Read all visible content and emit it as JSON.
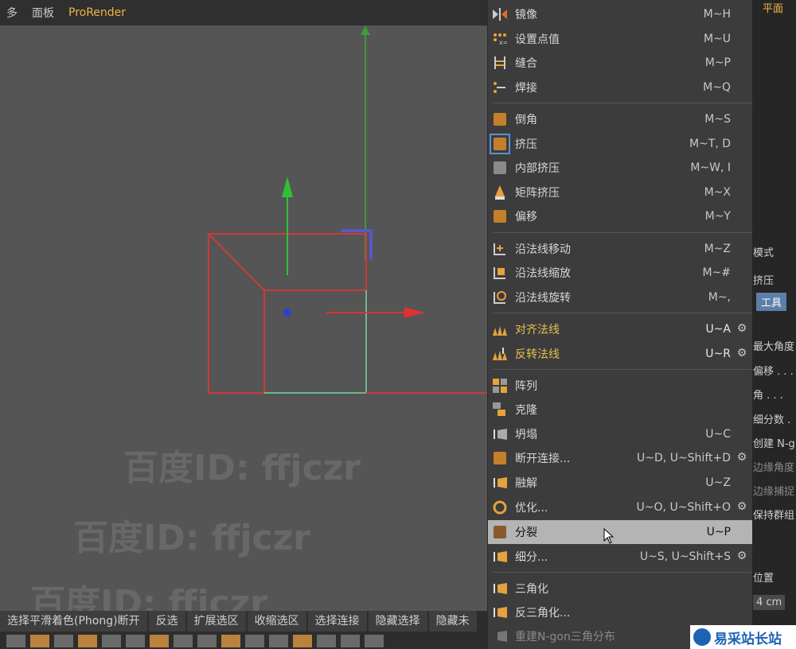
{
  "topbar": {
    "item_a": "多",
    "panels": "面板",
    "prorender": "ProRender"
  },
  "watermarks": [
    "百度ID: ffjczr",
    "百度ID: ffjczr",
    "百度ID: ffjczr"
  ],
  "bottom_buttons": [
    "选择平滑着色(Phong)断开",
    "反选",
    "扩展选区",
    "收缩选区",
    "选择连接",
    "隐藏选择",
    "隐藏未"
  ],
  "menu": {
    "items": [
      {
        "label": "镜像",
        "shortcut": "M~H",
        "icon": "mirror-icon"
      },
      {
        "label": "设置点值",
        "shortcut": "M~U",
        "icon": "set-point-value-icon"
      },
      {
        "label": "缝合",
        "shortcut": "M~P",
        "icon": "stitch-icon"
      },
      {
        "label": "焊接",
        "shortcut": "M~Q",
        "icon": "weld-icon"
      },
      {
        "label": "倒角",
        "shortcut": "M~S",
        "icon": "bevel-icon"
      },
      {
        "label": "挤压",
        "shortcut": "M~T, D",
        "icon": "extrude-icon"
      },
      {
        "label": "内部挤压",
        "shortcut": "M~W, I",
        "icon": "extrude-inner-icon"
      },
      {
        "label": "矩阵挤压",
        "shortcut": "M~X",
        "icon": "matrix-extrude-icon"
      },
      {
        "label": "偏移",
        "shortcut": "M~Y",
        "icon": "offset-icon"
      },
      {
        "label": "沿法线移动",
        "shortcut": "M~Z",
        "icon": "normal-move-icon"
      },
      {
        "label": "沿法线缩放",
        "shortcut": "M~#",
        "icon": "normal-scale-icon"
      },
      {
        "label": "沿法线旋转",
        "shortcut": "M~,",
        "icon": "normal-rotate-icon"
      },
      {
        "label": "对齐法线",
        "shortcut": "U~A",
        "icon": "align-normals-icon"
      },
      {
        "label": "反转法线",
        "shortcut": "U~R",
        "icon": "reverse-normals-icon"
      },
      {
        "label": "阵列",
        "shortcut": "",
        "icon": "array-icon"
      },
      {
        "label": "克隆",
        "shortcut": "",
        "icon": "clone-icon"
      },
      {
        "label": "坍塌",
        "shortcut": "U~C",
        "icon": "collapse-icon"
      },
      {
        "label": "断开连接...",
        "shortcut": "U~D, U~Shift+D",
        "icon": "disconnect-icon"
      },
      {
        "label": "融解",
        "shortcut": "U~Z",
        "icon": "melt-icon"
      },
      {
        "label": "优化...",
        "shortcut": "U~O, U~Shift+O",
        "icon": "optimize-icon"
      },
      {
        "label": "分裂",
        "shortcut": "U~P",
        "icon": "split-icon"
      },
      {
        "label": "细分...",
        "shortcut": "U~S, U~Shift+S",
        "icon": "subdivide-icon"
      },
      {
        "label": "三角化",
        "shortcut": "",
        "icon": "triangulate-icon"
      },
      {
        "label": "反三角化...",
        "shortcut": "",
        "icon": "untriangulate-icon"
      },
      {
        "label": "重建N-gon三角分布",
        "shortcut": "",
        "icon": "retriangulate-ngons-icon"
      }
    ]
  },
  "right_panel": {
    "tab_top": "平面",
    "mode": "模式",
    "extrude": "挤压",
    "tool_btn": "工具",
    "max_angle": "最大角度",
    "offset": "偏移 . . .",
    "angle": "角 . . .",
    "subdiv": "细分数 .",
    "create_ngon": "创建 N-g",
    "edge_angle": "边缘角度",
    "edge_snap": "边缘捕捉",
    "keep_groups": "保持群组",
    "position": "位置",
    "value_cm": "4 cm"
  },
  "logo": {
    "text": "易采站长站"
  },
  "colors": {
    "accent": "#f0b548",
    "highlight": "#b4b4b4",
    "menu_bg": "#3c3c3c",
    "viewport_bg": "#555555"
  }
}
